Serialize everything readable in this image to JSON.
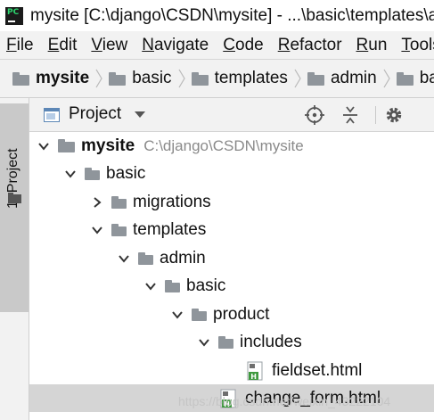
{
  "window": {
    "title": "mysite [C:\\django\\CSDN\\mysite] - ...\\basic\\templates\\admin\\basic\\product\\change_form.html"
  },
  "menu": {
    "items": [
      {
        "mnemonic": "F",
        "rest": "ile"
      },
      {
        "mnemonic": "E",
        "rest": "dit"
      },
      {
        "mnemonic": "V",
        "rest": "iew"
      },
      {
        "mnemonic": "N",
        "rest": "avigate"
      },
      {
        "mnemonic": "C",
        "rest": "ode"
      },
      {
        "mnemonic": "R",
        "rest": "efactor"
      },
      {
        "mnemonic": "R",
        "rest": "un"
      },
      {
        "mnemonic": "T",
        "rest": "ools"
      }
    ]
  },
  "breadcrumb": {
    "items": [
      "mysite",
      "basic",
      "templates",
      "admin",
      "basic"
    ]
  },
  "toolstrip": {
    "project_tab_label": "1: Project"
  },
  "project_panel": {
    "title": "Project",
    "icons": [
      "project-window-icon",
      "chevron-down-icon",
      "target-icon",
      "collapse-all-icon",
      "gear-icon"
    ]
  },
  "tree": {
    "rows": [
      {
        "label": "mysite",
        "path": "C:\\django\\CSDN\\mysite",
        "expanded": true,
        "type": "folder"
      },
      {
        "label": "basic",
        "expanded": true,
        "type": "folder"
      },
      {
        "label": "migrations",
        "expanded": false,
        "type": "folder"
      },
      {
        "label": "templates",
        "expanded": true,
        "type": "folder"
      },
      {
        "label": "admin",
        "expanded": true,
        "type": "folder"
      },
      {
        "label": "basic",
        "expanded": true,
        "type": "folder"
      },
      {
        "label": "product",
        "expanded": true,
        "type": "folder"
      },
      {
        "label": "includes",
        "expanded": true,
        "type": "folder"
      },
      {
        "label": "fieldset.html",
        "type": "html-file"
      },
      {
        "label": "change_form.html",
        "type": "html-file",
        "selected": true
      }
    ]
  },
  "watermark": "https://blog.csdn.net/weixin_43222104",
  "colors": {
    "selection": "#d5d5d5",
    "folder": "#8f959b",
    "html_icon": "#3f9a3f",
    "path_text": "#8a8a8a"
  }
}
